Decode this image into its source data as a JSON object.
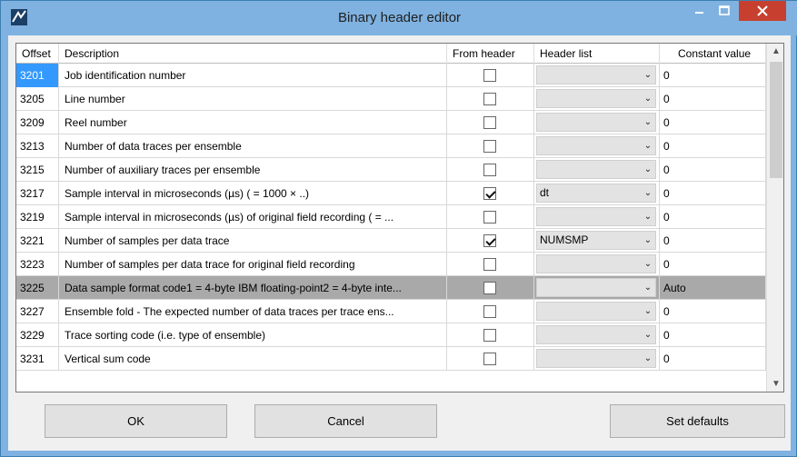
{
  "window": {
    "title": "Binary header editor"
  },
  "columns": {
    "offset": "Offset",
    "description": "Description",
    "from_header": "From header",
    "header_list": "Header list",
    "constant_value": "Constant value"
  },
  "rows": [
    {
      "offset": "3201",
      "description": "Job identification number",
      "from_header": false,
      "header_list": "",
      "constant": "0"
    },
    {
      "offset": "3205",
      "description": "Line number",
      "from_header": false,
      "header_list": "",
      "constant": "0"
    },
    {
      "offset": "3209",
      "description": "Reel number",
      "from_header": false,
      "header_list": "",
      "constant": "0"
    },
    {
      "offset": "3213",
      "description": "Number of data traces per ensemble",
      "from_header": false,
      "header_list": "",
      "constant": "0"
    },
    {
      "offset": "3215",
      "description": "Number of auxiliary traces per ensemble",
      "from_header": false,
      "header_list": "",
      "constant": "0"
    },
    {
      "offset": "3217",
      "description": "Sample interval in microseconds (µs)   ( = 1000 × ..)",
      "from_header": true,
      "header_list": "dt",
      "constant": "0"
    },
    {
      "offset": "3219",
      "description": "Sample interval in microseconds (µs) of original field recording   ( = ...",
      "from_header": false,
      "header_list": "",
      "constant": "0"
    },
    {
      "offset": "3221",
      "description": "Number of samples per data trace",
      "from_header": true,
      "header_list": "NUMSMP",
      "constant": "0"
    },
    {
      "offset": "3223",
      "description": "Number of samples per data trace for original field recording",
      "from_header": false,
      "header_list": "",
      "constant": "0"
    },
    {
      "offset": "3225",
      "description": "Data sample format code1 = 4-byte IBM floating-point2 = 4-byte inte...",
      "from_header": false,
      "header_list": "",
      "constant": "Auto"
    },
    {
      "offset": "3227",
      "description": "Ensemble fold - The expected number of data traces per trace ens...",
      "from_header": false,
      "header_list": "",
      "constant": "0"
    },
    {
      "offset": "3229",
      "description": "Trace sorting code (i.e. type of ensemble)",
      "from_header": false,
      "header_list": "",
      "constant": "0"
    },
    {
      "offset": "3231",
      "description": "Vertical sum code",
      "from_header": false,
      "header_list": "",
      "constant": "0"
    }
  ],
  "buttons": {
    "ok": "OK",
    "cancel": "Cancel",
    "set_defaults": "Set defaults"
  },
  "icons": {
    "app": "app-icon",
    "minimize": "minimize-icon",
    "maximize": "maximize-icon",
    "close": "close-icon",
    "dropdown": "chevron-down-icon"
  },
  "colors": {
    "titlebar": "#7fb2e0",
    "close_button": "#c7402f",
    "selected_row": "#a9a9a9",
    "first_offset_highlight": "#3399ff"
  }
}
